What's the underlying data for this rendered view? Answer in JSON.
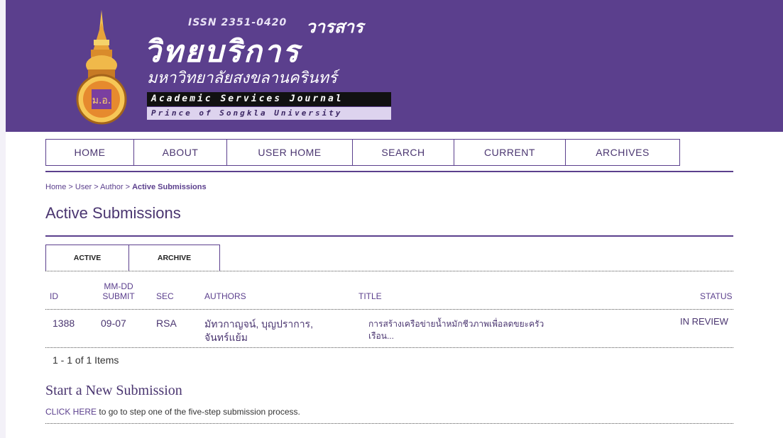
{
  "header": {
    "issn": "ISSN 2351-0420",
    "journal_word_thai": "วารสาร",
    "journal_title_thai": "วิทยบริการ",
    "university_thai": "มหาวิทยาลัยสงขลานครินทร์",
    "journal_title_en": "Academic Services Journal",
    "university_en": "Prince of Songkla University"
  },
  "nav": [
    "HOME",
    "ABOUT",
    "USER HOME",
    "SEARCH",
    "CURRENT",
    "ARCHIVES"
  ],
  "breadcrumb": {
    "home": "Home",
    "user": "User",
    "author": "Author",
    "current": "Active Submissions",
    "sep": ">"
  },
  "page_title": "Active Submissions",
  "tabs": [
    "ACTIVE",
    "ARCHIVE"
  ],
  "table": {
    "headers": {
      "id": "ID",
      "mmdd": "MM-DD",
      "submit": "SUBMIT",
      "sec": "SEC",
      "authors": "AUTHORS",
      "title": "TITLE",
      "status": "STATUS"
    },
    "rows": [
      {
        "id": "1388",
        "date": "09-07",
        "sec": "RSA",
        "authors_line1": "มัทวกาญจน์, บุญปราการ,",
        "authors_line2": "จันทร์แย้ม",
        "title_line1": "การสร้างเครือข่ายน้ำหมักชีวภาพเพื่อลดขยะครัว",
        "title_line2": "เรือน...",
        "status": "IN REVIEW"
      }
    ]
  },
  "paging": "1 - 1 of 1 Items",
  "new_submission": {
    "title": "Start a New Submission",
    "link_text": "CLICK HERE",
    "rest_text": " to go to step one of the five-step submission process."
  },
  "colors": {
    "header_bg": "#5b3f8d",
    "accent": "#5b3f8d"
  }
}
